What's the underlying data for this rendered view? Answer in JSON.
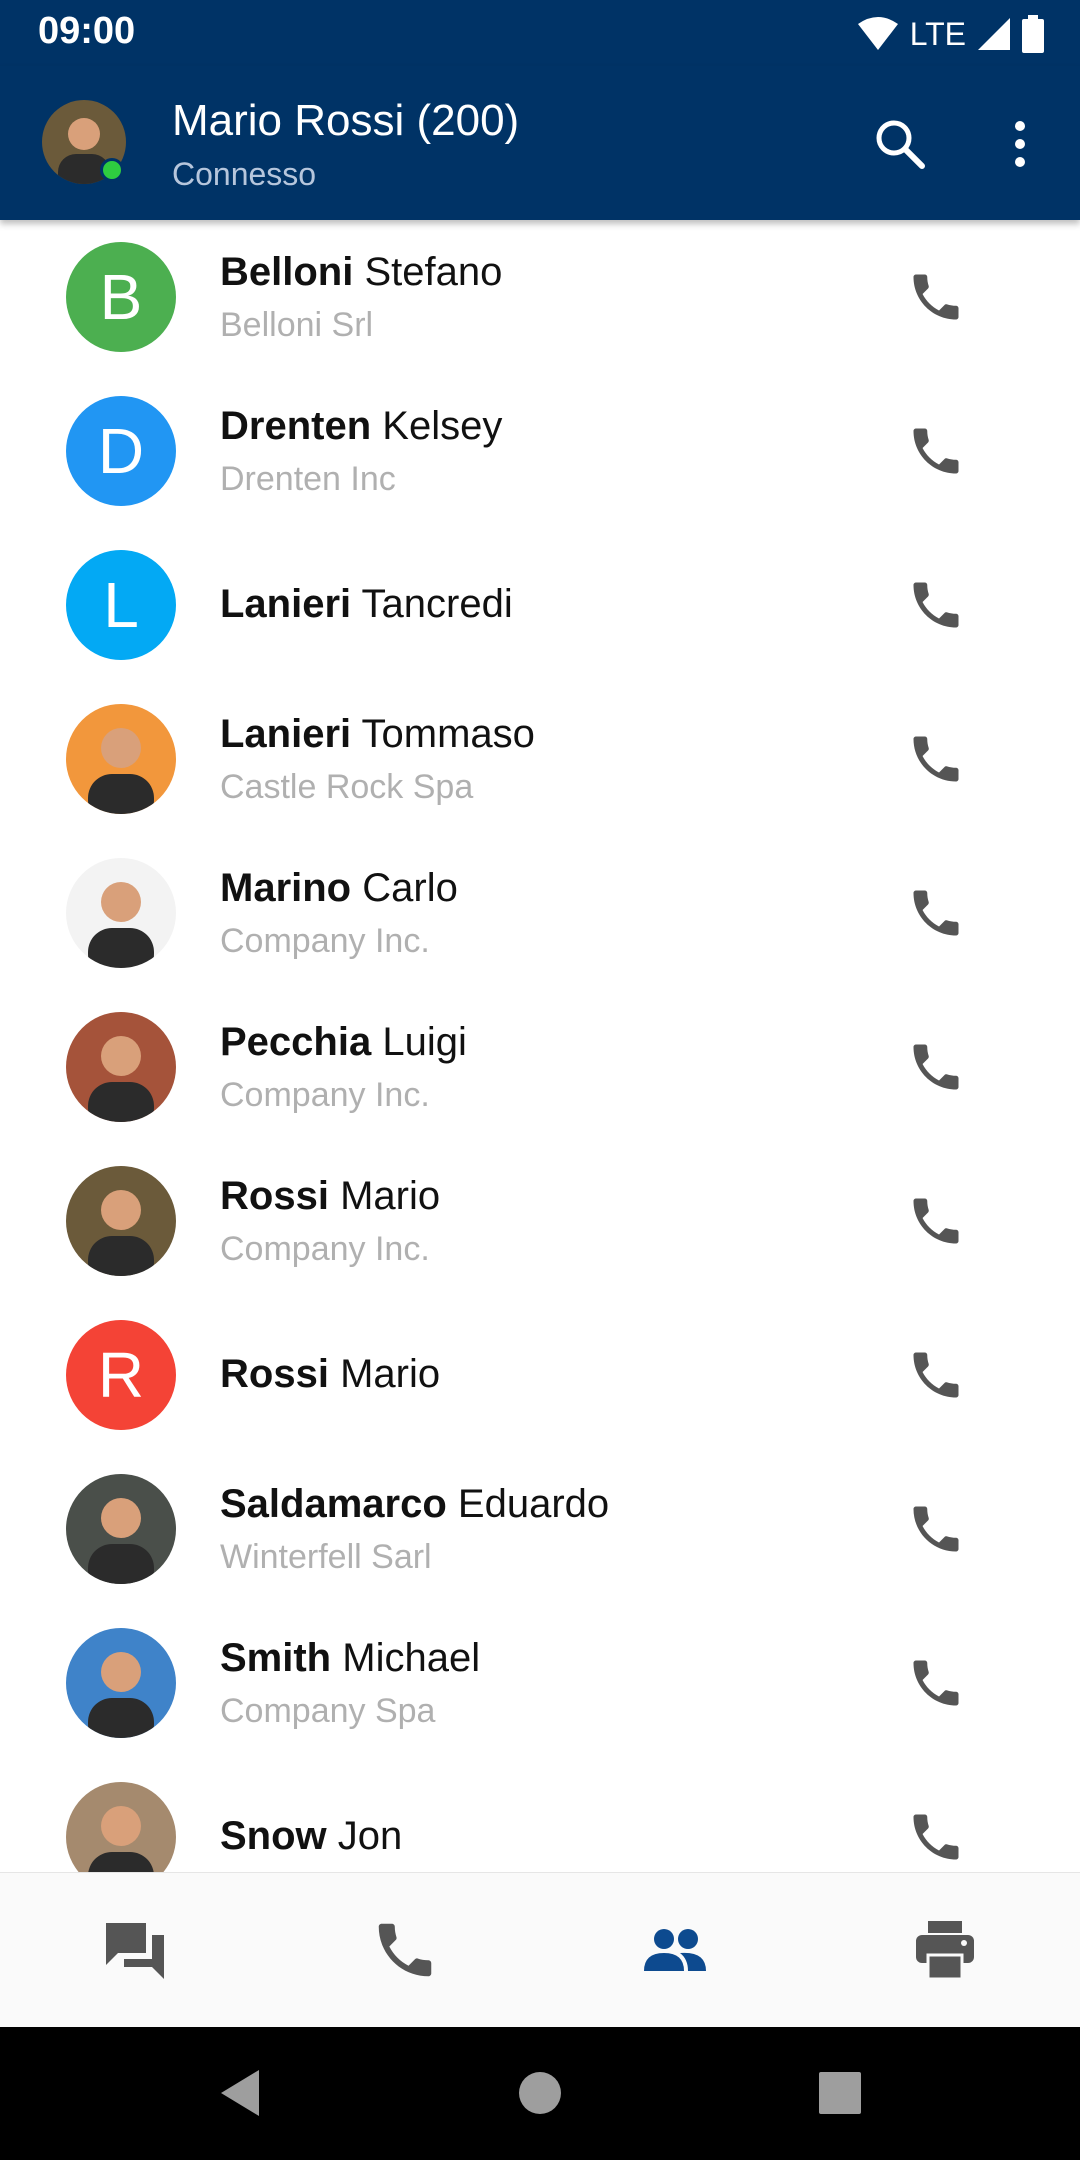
{
  "status_bar": {
    "time": "09:00",
    "network": "LTE"
  },
  "app_bar": {
    "title": "Mario Rossi (200)",
    "subtitle": "Connesso",
    "status_color": "#2ecc40",
    "icons": [
      "search-icon",
      "more-vert-icon"
    ]
  },
  "contacts": [
    {
      "last": "Belloni",
      "first": "Stefano",
      "company": "Belloni Srl",
      "avatar": {
        "type": "letter",
        "letter": "B",
        "color": "#4CAF50"
      }
    },
    {
      "last": "Drenten",
      "first": "Kelsey",
      "company": "Drenten Inc",
      "avatar": {
        "type": "letter",
        "letter": "D",
        "color": "#2196F3"
      }
    },
    {
      "last": "Lanieri",
      "first": "Tancredi",
      "company": "",
      "avatar": {
        "type": "letter",
        "letter": "L",
        "color": "#03A9F4"
      }
    },
    {
      "last": "Lanieri",
      "first": "Tommaso",
      "company": "Castle Rock Spa",
      "avatar": {
        "type": "photo",
        "bg": "#f2973c"
      }
    },
    {
      "last": "Marino",
      "first": "Carlo",
      "company": "Company Inc.",
      "avatar": {
        "type": "photo",
        "bg": "#f3f3f3"
      }
    },
    {
      "last": "Pecchia",
      "first": "Luigi",
      "company": "Company Inc.",
      "avatar": {
        "type": "photo",
        "bg": "#a5533a"
      }
    },
    {
      "last": "Rossi",
      "first": "Mario",
      "company": "Company Inc.",
      "avatar": {
        "type": "photo",
        "bg": "#6b5a3a"
      }
    },
    {
      "last": "Rossi",
      "first": "Mario",
      "company": "",
      "avatar": {
        "type": "letter",
        "letter": "R",
        "color": "#F44336"
      }
    },
    {
      "last": "Saldamarco",
      "first": "Eduardo",
      "company": "Winterfell Sarl",
      "avatar": {
        "type": "photo",
        "bg": "#4a4f4a"
      }
    },
    {
      "last": "Smith",
      "first": "Michael",
      "company": "Company Spa",
      "avatar": {
        "type": "photo",
        "bg": "#3f83c9"
      }
    },
    {
      "last": "Snow",
      "first": "Jon",
      "company": "",
      "avatar": {
        "type": "photo",
        "bg": "#a58a6e"
      }
    }
  ],
  "bottom_nav": {
    "items": [
      "chat-icon",
      "phone-icon",
      "contacts-icon",
      "fax-icon"
    ],
    "active": "contacts-icon",
    "active_color": "#0d4a8f",
    "inactive_color": "#555555"
  },
  "android_nav": [
    "back-icon",
    "home-icon",
    "recents-icon"
  ]
}
